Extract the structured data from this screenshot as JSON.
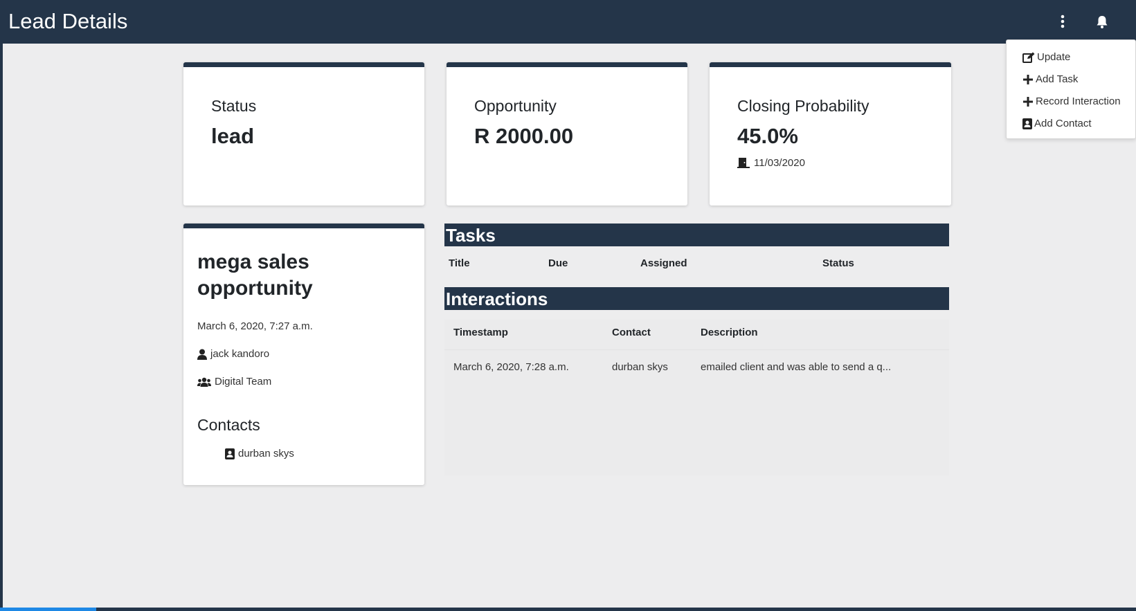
{
  "header": {
    "title": "Lead Details",
    "menu_icon": "kebab-vertical-icon",
    "notification_icon": "bell-icon"
  },
  "dropdown": {
    "items": [
      {
        "label": "Update",
        "icon": "edit-icon"
      },
      {
        "label": "Add Task",
        "icon": "plus-icon"
      },
      {
        "label": "Record Interaction",
        "icon": "plus-icon"
      },
      {
        "label": "Add Contact",
        "icon": "contact-card-icon"
      }
    ]
  },
  "cards": {
    "status": {
      "label": "Status",
      "value": "lead"
    },
    "opportunity": {
      "label": "Opportunity",
      "value": "R 2000.00"
    },
    "probability": {
      "label": "Closing Probability",
      "value": "45.0%",
      "date": "11/03/2020",
      "date_icon": "door-closed-icon"
    }
  },
  "lead": {
    "title": "mega sales opportunity",
    "created": "March 6, 2020, 7:27 a.m.",
    "owner": "jack kandoro",
    "team": "Digital Team",
    "contacts_heading": "Contacts",
    "contacts": [
      "durban skys"
    ]
  },
  "tasks": {
    "heading": "Tasks",
    "columns": [
      "Title",
      "Due",
      "Assigned",
      "Status"
    ]
  },
  "interactions": {
    "heading": "Interactions",
    "columns": [
      "Timestamp",
      "Contact",
      "Description"
    ],
    "rows": [
      {
        "timestamp": "March 6, 2020, 7:28 a.m.",
        "contact": "durban skys",
        "description": "emailed client and was able to send a q..."
      }
    ]
  },
  "progress": {
    "fraction": 0.085
  },
  "colors": {
    "navy": "#243549",
    "background": "#ededee",
    "progress": "#1e88e5"
  }
}
